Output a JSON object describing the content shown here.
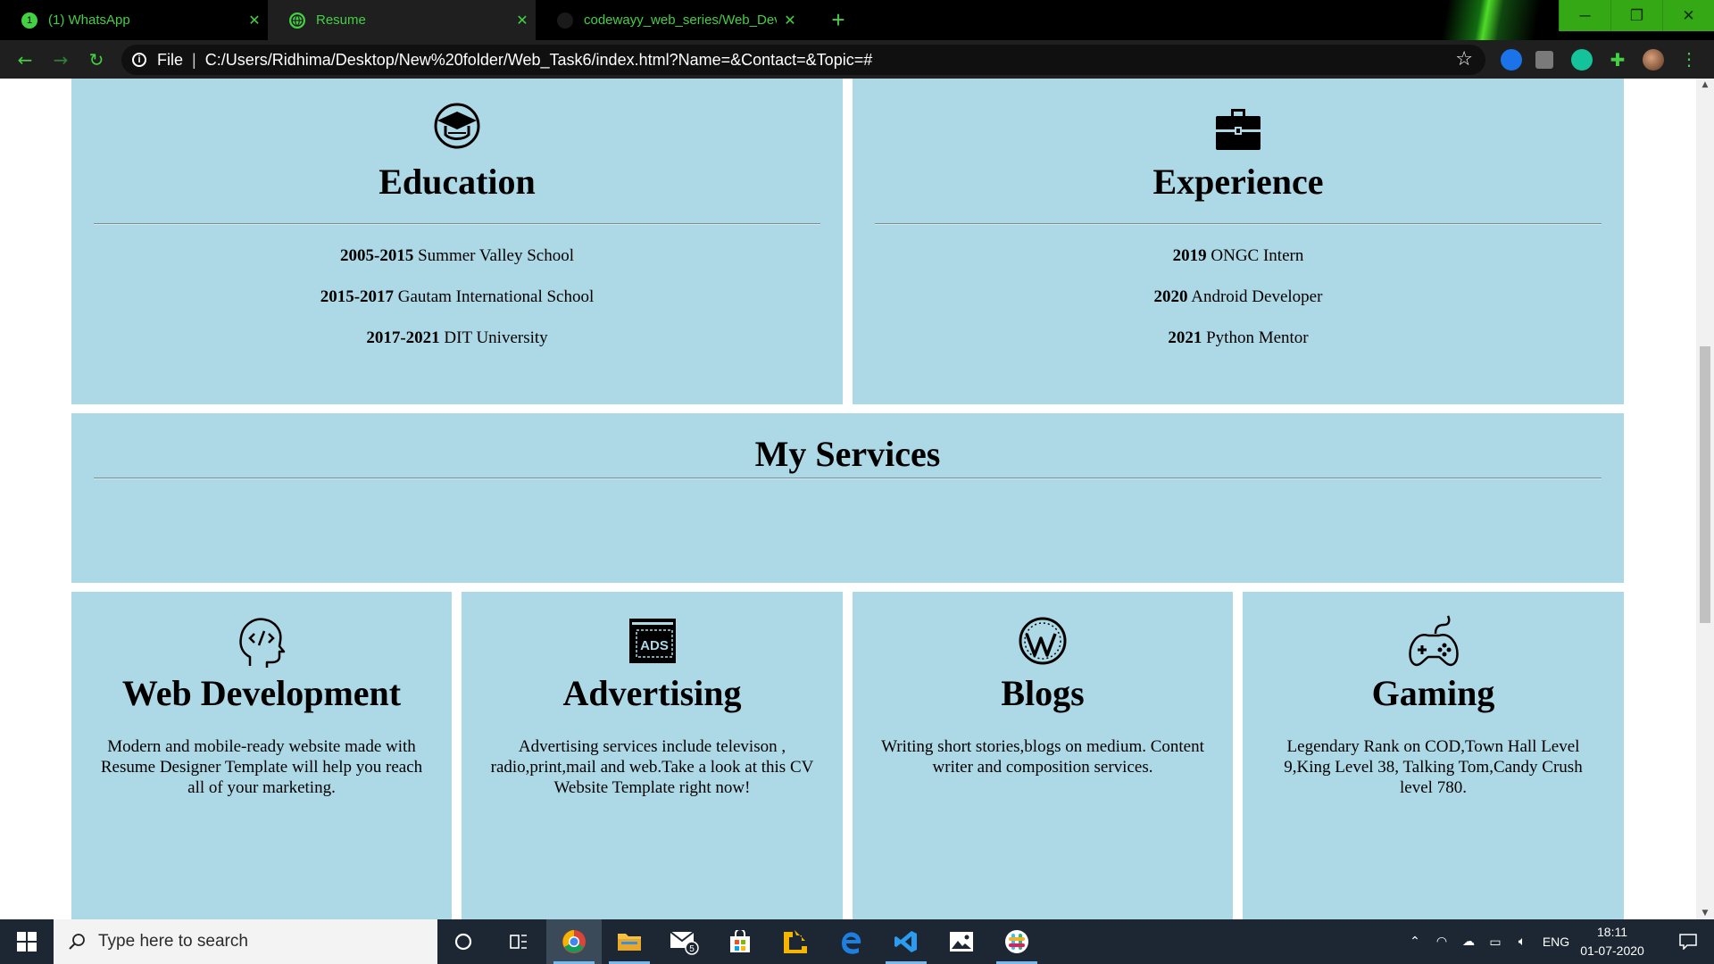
{
  "browser": {
    "tabs": [
      {
        "title": "(1) WhatsApp",
        "favicon": "whatsapp-icon",
        "badge": "1"
      },
      {
        "title": "Resume",
        "favicon": "globe-icon"
      },
      {
        "title": "codewayy_web_series/Web_Dev",
        "favicon": "github-icon"
      }
    ],
    "new_tab_label": "+",
    "window_controls": {
      "minimize": "─",
      "maximize": "❐",
      "close": "✕"
    },
    "nav": {
      "back": "←",
      "forward": "→",
      "reload": "↻"
    },
    "address": {
      "scheme_label": "File",
      "separator": "|",
      "url": "C:/Users/Ridhima/Desktop/New%20folder/Web_Task6/index.html?Name=&Contact=&Topic=#"
    },
    "accent_color": "#43d043"
  },
  "page": {
    "education": {
      "heading": "Education",
      "icon": "graduation-cap-icon",
      "items": [
        {
          "years": "2005-2015",
          "name": "Summer Valley School"
        },
        {
          "years": "2015-2017",
          "name": "Gautam International School"
        },
        {
          "years": "2017-2021",
          "name": "DIT University"
        }
      ]
    },
    "experience": {
      "heading": "Experience",
      "icon": "briefcase-icon",
      "items": [
        {
          "years": "2019",
          "name": "ONGC Intern"
        },
        {
          "years": "2020",
          "name": "Android Developer"
        },
        {
          "years": "2021",
          "name": "Python Mentor"
        }
      ]
    },
    "services_heading": "My Services",
    "services": [
      {
        "title": "Web Development",
        "icon": "code-head-icon",
        "text": "Modern and mobile-ready website made with Resume Designer Template will help you reach all of your marketing."
      },
      {
        "title": "Advertising",
        "icon": "ads-icon",
        "icon_text": "ADS",
        "text": "Advertising services include televison , radio,print,mail and web.Take a look at this CV Website Template right now!"
      },
      {
        "title": "Blogs",
        "icon": "wordpress-icon",
        "text": "Writing short stories,blogs on medium. Content writer and composition services."
      },
      {
        "title": "Gaming",
        "icon": "gamepad-icon",
        "text": "Legendary Rank on COD,Town Hall Level 9,King Level 38, Talking Tom,Candy Crush level 780."
      }
    ],
    "card_color": "#add8e6"
  },
  "taskbar": {
    "search_placeholder": "Type here to search",
    "mail_badge": "5",
    "language": "ENG",
    "time": "18:11",
    "date": "01-07-2020"
  }
}
